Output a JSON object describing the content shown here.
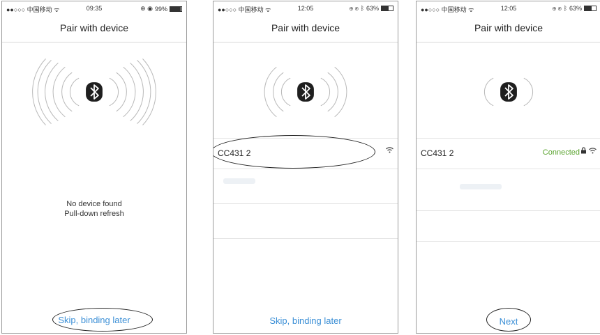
{
  "screens": [
    {
      "status": {
        "carrier": "●●○○○ 中国移动 ᯤ",
        "time": "09:35",
        "battery": "99%",
        "battery_level": 0.99
      },
      "title": "Pair with device",
      "message_line1": "No device found",
      "message_line2": "Pull-down refresh",
      "action": "Skip, binding later"
    },
    {
      "status": {
        "carrier": "●●○○○ 中国移动 ᯤ",
        "time": "12:05",
        "battery": "63%",
        "battery_level": 0.63
      },
      "title": "Pair with device",
      "device": {
        "name": "CC431 2"
      },
      "action": "Skip, binding later"
    },
    {
      "status": {
        "carrier": "●●○○○ 中国移动 ᯤ",
        "time": "12:05",
        "battery": "63%",
        "battery_level": 0.63
      },
      "title": "Pair with device",
      "device": {
        "name": "CC431 2",
        "status": "Connected"
      },
      "action": "Next"
    }
  ],
  "colors": {
    "link": "#3b8fd6",
    "connected": "#5aa42f"
  },
  "icons": [
    "bluetooth-icon",
    "wifi-icon",
    "lock-icon",
    "alarm-icon",
    "battery-icon"
  ]
}
